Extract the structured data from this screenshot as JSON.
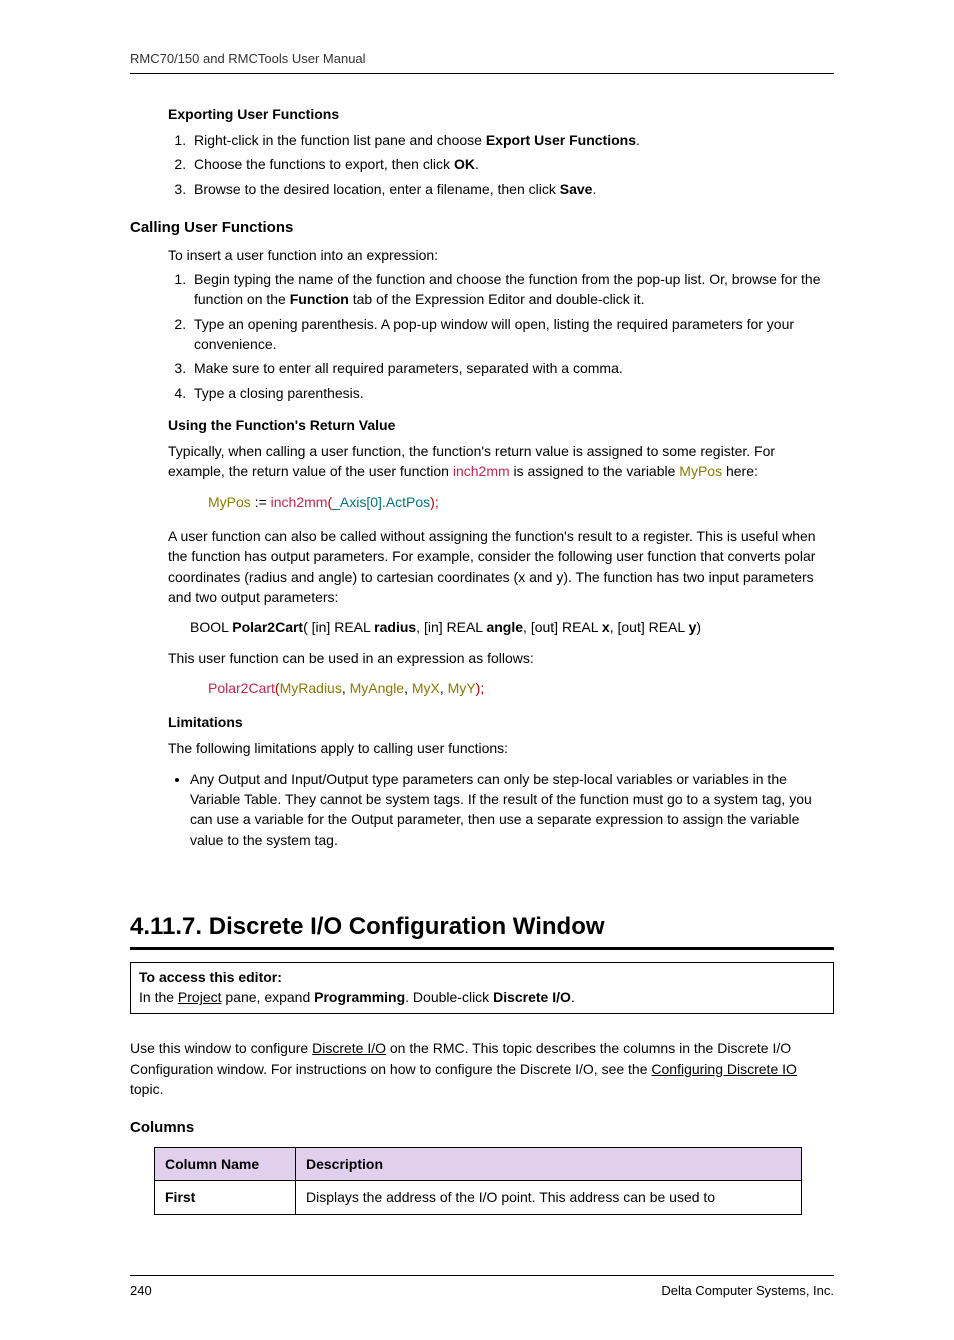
{
  "header": "RMC70/150 and RMCTools User Manual",
  "section_export_heading": "Exporting User Functions",
  "export_steps": [
    {
      "prefix": "Right-click in the function list pane and choose ",
      "bold": "Export User Functions",
      "suffix": "."
    },
    {
      "prefix": "Choose the functions to export, then click ",
      "bold": "OK",
      "suffix": "."
    },
    {
      "prefix": "Browse to the desired location, enter a filename, then click ",
      "bold": "Save",
      "suffix": "."
    }
  ],
  "calling_heading": "Calling User Functions",
  "calling_intro": "To insert a user function into an expression:",
  "calling_steps": [
    {
      "text": "Begin typing the name of the function and choose the function from the pop-up list. Or, browse for the function on the ",
      "bold": "Function",
      "suffix": " tab of the Expression Editor and double-click it."
    },
    {
      "text": "Type an opening parenthesis. A pop-up window will open, listing the required parameters for your convenience."
    },
    {
      "text": "Make sure to enter all required parameters, separated with a comma."
    },
    {
      "text": "Type a closing parenthesis."
    }
  ],
  "using_return_heading": "Using the Function's Return Value",
  "using_return_text1": "Typically, when calling a user function, the function's return value is assigned to some register. For example, the return value of the user function ",
  "using_return_fn": "inch2mm",
  "using_return_text2": " is assigned to the variable ",
  "using_return_var": "MyPos",
  "using_return_text3": " here:",
  "code1": {
    "mypos": "MyPos",
    "assign": " := ",
    "fn": "inch2mm",
    "open": "(",
    "arg": "_Axis[0].ActPos",
    "close": ");"
  },
  "after_code1_para": "A user function can also be called without assigning the function's result to a register. This is useful when the function has output parameters. For example, consider the following user function that converts polar coordinates (radius and angle) to cartesian coordinates (x and y). The function has two input parameters and two output parameters:",
  "signature": {
    "ret": "BOOL ",
    "name": "Polar2Cart",
    "open": "( [in] REAL ",
    "p1": "radius",
    "sep1": ", [in] REAL ",
    "p2": "angle",
    "sep2": ", [out] REAL ",
    "p3": "x",
    "sep3": ", [out] REAL ",
    "p4": "y",
    "close": ")"
  },
  "after_sig_text": "This user function can be used in an expression as follows:",
  "code2": {
    "fn": "Polar2Cart",
    "open": "(",
    "a1": "MyRadius",
    "c1": ", ",
    "a2": "MyAngle",
    "c2": ", ",
    "a3": "MyX",
    "c3": ", ",
    "a4": "MyY",
    "close": ");"
  },
  "limitations_heading": "Limitations",
  "limitations_intro": "The following limitations apply to calling user functions:",
  "limitations_bullet": "Any Output and Input/Output type parameters can only be step-local variables or variables in the Variable Table. They cannot be system tags. If the result of the function must go to a system tag, you can use a variable for the Output parameter, then use a separate expression to assign the variable value to the system tag.",
  "big_heading": "4.11.7. Discrete I/O Configuration Window",
  "access": {
    "title": "To access this editor:",
    "pre": "In the ",
    "link1": "Project",
    "mid": " pane, expand ",
    "bold1": "Programming",
    "mid2": ". Double-click ",
    "bold2": "Discrete I/O",
    "end": "."
  },
  "config_para": {
    "pre": "Use this window to configure ",
    "link1": "Discrete I/O",
    "mid": " on the RMC. This topic describes the columns in the Discrete I/O Configuration window. For instructions on how to configure the Discrete I/O, see the ",
    "link2": "Configuring Discrete IO",
    "end": " topic."
  },
  "columns_heading": "Columns",
  "table": {
    "h1": "Column Name",
    "h2": "Description",
    "r1c1": "First",
    "r1c2": "Displays the address of the I/O point. This address can be used to"
  },
  "footer": {
    "page": "240",
    "company": "Delta Computer Systems, Inc."
  }
}
